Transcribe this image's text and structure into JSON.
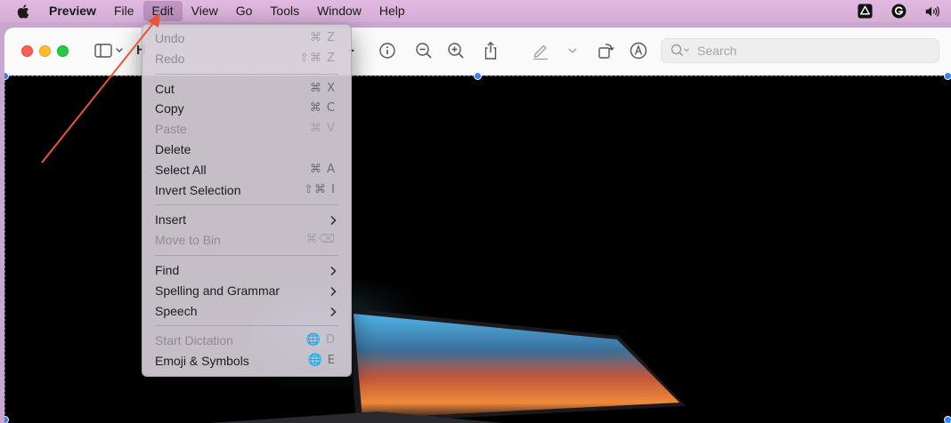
{
  "menubar": {
    "app_name": "Preview",
    "items": [
      "File",
      "Edit",
      "View",
      "Go",
      "Tools",
      "Window",
      "Help"
    ],
    "active_item": "Edit"
  },
  "toolbar": {
    "title_fragment": "H",
    "overflow": "..",
    "search_placeholder": "Search"
  },
  "edit_menu": {
    "undo": {
      "label": "Undo",
      "shortcut": "⌘ Z"
    },
    "redo": {
      "label": "Redo",
      "shortcut": "⇧⌘ Z"
    },
    "cut": {
      "label": "Cut",
      "shortcut": "⌘ X"
    },
    "copy": {
      "label": "Copy",
      "shortcut": "⌘ C"
    },
    "paste": {
      "label": "Paste",
      "shortcut": "⌘ V"
    },
    "delete": {
      "label": "Delete"
    },
    "select_all": {
      "label": "Select All",
      "shortcut": "⌘ A"
    },
    "invert_selection": {
      "label": "Invert Selection",
      "shortcut": "⇧⌘ I"
    },
    "insert": {
      "label": "Insert"
    },
    "move_to_bin": {
      "label": "Move to Bin",
      "shortcut": "⌘⌫"
    },
    "find": {
      "label": "Find"
    },
    "spelling": {
      "label": "Spelling and Grammar"
    },
    "speech": {
      "label": "Speech"
    },
    "start_dictation": {
      "label": "Start Dictation",
      "shortcut": "🌐 D"
    },
    "emoji": {
      "label": "Emoji & Symbols",
      "shortcut": "🌐 E"
    }
  },
  "colors": {
    "menubar_bg": "#d5aed6",
    "annotation_arrow": "#e8553a",
    "selection_handle": "#3b82f6"
  },
  "icons": [
    "apple-icon",
    "drive-icon",
    "grammarly-icon",
    "volume-icon",
    "sidebar-toggle-icon",
    "info-icon",
    "zoom-out-icon",
    "zoom-in-icon",
    "share-icon",
    "highlight-icon",
    "rotate-icon",
    "markup-icon",
    "search-icon"
  ]
}
